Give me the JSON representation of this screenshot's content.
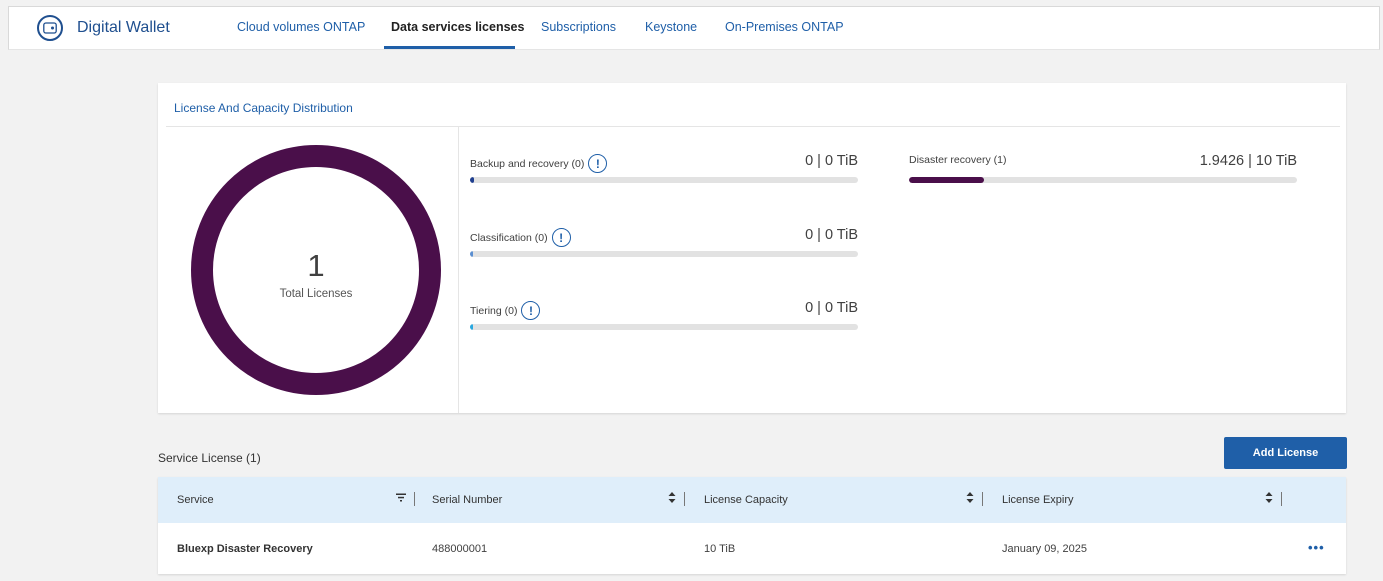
{
  "header": {
    "app_title": "Digital Wallet",
    "brand_icon": "wallet-icon",
    "tabs": [
      {
        "label": "Cloud volumes ONTAP",
        "active": false
      },
      {
        "label": "Data services licenses",
        "active": true
      },
      {
        "label": "Subscriptions",
        "active": false
      },
      {
        "label": "Keystone",
        "active": false
      },
      {
        "label": "On-Premises ONTAP",
        "active": false
      }
    ]
  },
  "distribution": {
    "title": "License And Capacity Distribution",
    "total_value": "1",
    "total_label": "Total Licenses",
    "donut_color": "#4a0f4a",
    "metrics": [
      {
        "label": "Backup and recovery (0)",
        "value": "0 | 0 TiB",
        "has_info": true,
        "fill_fraction": 0.01,
        "color": "#1f3f8f"
      },
      {
        "label": "Classification (0)",
        "value": "0 | 0 TiB",
        "has_info": true,
        "fill_fraction": 0.005,
        "color": "#5b8fd1"
      },
      {
        "label": "Tiering (0)",
        "value": "0 | 0 TiB",
        "has_info": true,
        "fill_fraction": 0.008,
        "color": "#29a8e0"
      },
      {
        "label": "Disaster recovery (1)",
        "value": "1.9426 | 10 TiB",
        "has_info": false,
        "fill_fraction": 0.194,
        "color": "#4a0f4a"
      }
    ]
  },
  "service_license": {
    "title": "Service License (1)",
    "add_button": "Add License",
    "columns": [
      "Service",
      "Serial Number",
      "License Capacity",
      "License Expiry"
    ],
    "rows": [
      {
        "service": "Bluexp Disaster Recovery",
        "serial": "488000001",
        "capacity": "10 TiB",
        "expiry": "January 09, 2025"
      }
    ],
    "row_menu_icon": "more-icon",
    "more_glyph": "•••"
  },
  "colors": {
    "accent": "#1f5fa8",
    "header_bg": "#dfeefa"
  }
}
